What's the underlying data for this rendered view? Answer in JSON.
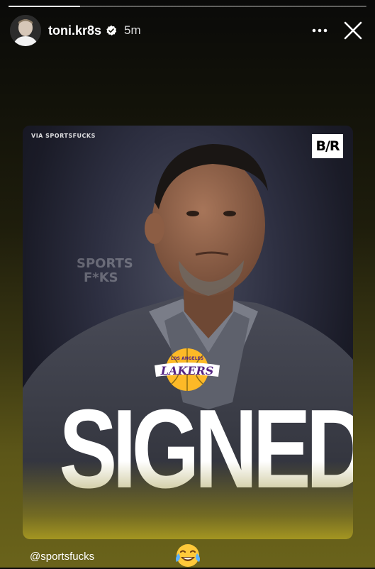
{
  "story": {
    "progress_fraction": 0.2,
    "username": "toni.kr8s",
    "verified": true,
    "time_ago": "5m",
    "more_icon": "more-horizontal-icon",
    "close_icon": "close-icon"
  },
  "post": {
    "via_text": "VIA SPORTSFUCKS",
    "brand_logo": "B/R",
    "watermark": "SPORTS F*KS",
    "team_logo": "LOS ANGELES LAKERS",
    "headline": "SIGNED"
  },
  "footer": {
    "mention": "@sportsfucks",
    "emoji": "face-with-tears-of-joy"
  },
  "colors": {
    "accent_gold": "#FDB927",
    "lakers_purple": "#552583",
    "verified_fill": "#FFFFFF"
  }
}
